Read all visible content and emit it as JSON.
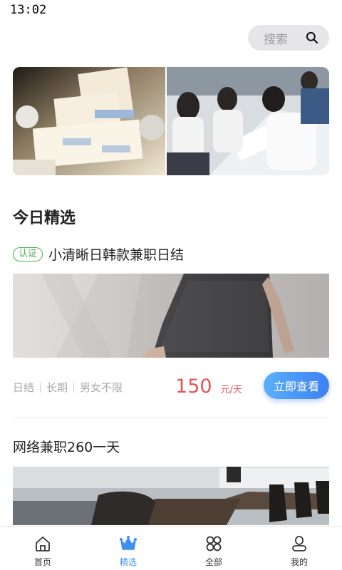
{
  "status_bar": {
    "time": "13:02"
  },
  "search": {
    "label": "搜索",
    "icon": "search-icon"
  },
  "banner": {
    "slides": [
      "product-boxes-photo",
      "students-working-photo"
    ]
  },
  "section": {
    "title": "今日精选"
  },
  "job1": {
    "badge": "认证",
    "title": "小清晰日韩款兼职日结",
    "tags": [
      "日结",
      "长期",
      "男女不限"
    ],
    "price": "150",
    "price_unit": "元/天",
    "button_label": "立即查看"
  },
  "job2": {
    "title": "网络兼职260一天"
  },
  "tabbar": {
    "items": [
      {
        "label": "首页",
        "icon": "home-icon",
        "active": false
      },
      {
        "label": "精选",
        "icon": "crown-icon",
        "active": true
      },
      {
        "label": "全部",
        "icon": "grid-icon",
        "active": false
      },
      {
        "label": "我的",
        "icon": "user-icon",
        "active": false
      }
    ],
    "active_color": "#3d8ff0"
  },
  "colors": {
    "accent": "#3d7ff3",
    "price": "#e4555a",
    "badge": "#4caf50"
  }
}
